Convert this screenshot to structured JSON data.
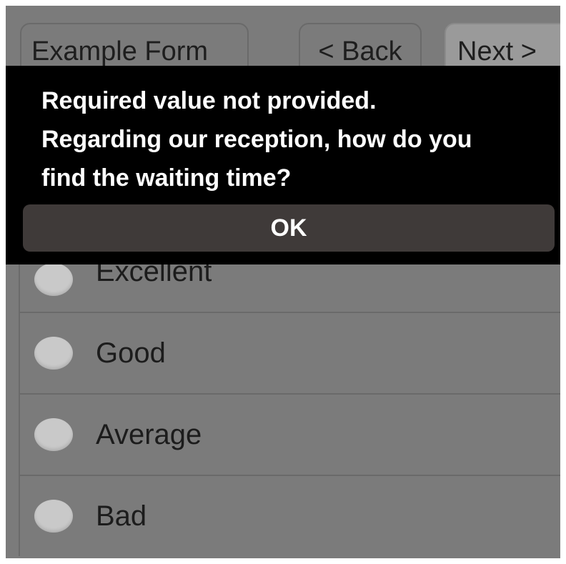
{
  "header": {
    "form_title": "Example Form",
    "back_label": "< Back",
    "next_label": "Next >"
  },
  "question": {
    "options": [
      {
        "label": "Excellent"
      },
      {
        "label": "Good"
      },
      {
        "label": "Average"
      },
      {
        "label": "Bad"
      }
    ]
  },
  "dialog": {
    "message_line1": "Required value not provided.",
    "message_line2": "Regarding our reception, how do you",
    "message_line3": "find the waiting time?",
    "ok_label": "OK"
  },
  "colors": {
    "dim_background": "#7b7b7b",
    "dialog_background": "#000000",
    "ok_button_background": "#3f3a39",
    "radio_fill": "#c9c9c9"
  }
}
